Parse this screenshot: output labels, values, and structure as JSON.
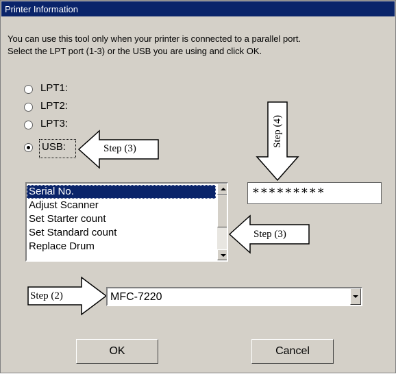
{
  "window": {
    "title": "Printer Information"
  },
  "intro": {
    "line1": "You can use this tool only when your printer is connected to a parallel port.",
    "line2": "Select the LPT port (1-3) or the USB you are using and click OK."
  },
  "ports": [
    {
      "label": "LPT1:",
      "selected": false
    },
    {
      "label": "LPT2:",
      "selected": false
    },
    {
      "label": "LPT3:",
      "selected": false
    },
    {
      "label": "USB:",
      "selected": true
    }
  ],
  "callouts": {
    "usb_step": "Step (3)",
    "list_step": "Step (3)",
    "serial_step": "Step (4)",
    "model_step": "Step (2)"
  },
  "function_list": {
    "items": [
      "Serial No.",
      "Adjust Scanner",
      "Set Starter count",
      "Set Standard count",
      "Replace Drum"
    ],
    "selected_index": 0
  },
  "serial_field": {
    "value": "*********"
  },
  "model_select": {
    "value": "MFC-7220"
  },
  "buttons": {
    "ok": "OK",
    "cancel": "Cancel"
  },
  "colors": {
    "dialog_bg": "#d4d0c8",
    "titlebar": "#0a246a",
    "selection": "#0a246a"
  }
}
